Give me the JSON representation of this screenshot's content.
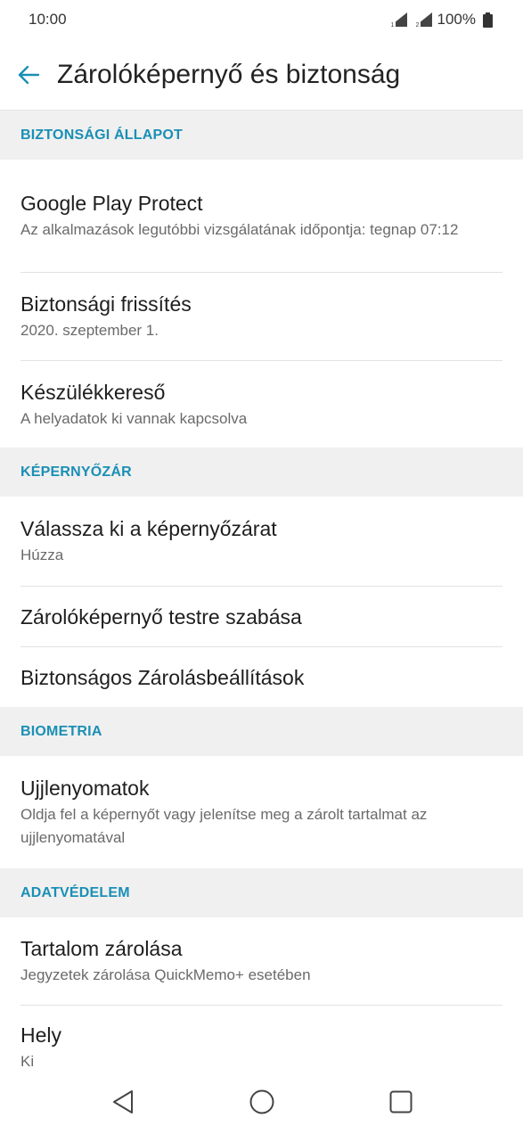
{
  "status_bar": {
    "time": "10:00",
    "battery_text": "100%",
    "sim1_label": "1",
    "sim2_label": "2",
    "icons": [
      "sim1-signal-icon",
      "sim2-signal-icon",
      "battery-icon"
    ]
  },
  "app_bar": {
    "title": "Zárolóképernyő és biztonság",
    "back_icon": "back-arrow-icon"
  },
  "colors": {
    "accent": "#1a8fb5",
    "section_bg": "#f0f0f0",
    "divider": "#e2e2e2"
  },
  "sections": {
    "security_status": {
      "header": "BIZTONSÁGI ÁLLAPOT",
      "items": [
        {
          "title": "Google Play Protect",
          "subtitle": "Az alkalmazások legutóbbi vizsgálatának időpontja: tegnap 07:12"
        },
        {
          "title": "Biztonsági frissítés",
          "subtitle": "2020. szeptember 1."
        },
        {
          "title": "Készülékkereső",
          "subtitle": "A helyadatok ki vannak kapcsolva"
        }
      ]
    },
    "screen_lock": {
      "header": "KÉPERNYŐZÁR",
      "items": [
        {
          "title": "Válassza ki a képernyőzárat",
          "subtitle": "Húzza"
        },
        {
          "title": "Zárolóképernyő testre szabása"
        },
        {
          "title": "Biztonságos Zárolásbeállítások"
        }
      ]
    },
    "biometrics": {
      "header": "BIOMETRIA",
      "items": [
        {
          "title": "Ujjlenyomatok",
          "subtitle": "Oldja fel a képernyőt vagy jelenítse meg a zárolt tartalmat az ujjlenyomatával"
        }
      ]
    },
    "privacy": {
      "header": "ADATVÉDELEM",
      "items": [
        {
          "title": "Tartalom zárolása",
          "subtitle": "Jegyzetek zárolása QuickMemo+ esetében"
        },
        {
          "title": "Hely",
          "subtitle": "Ki"
        }
      ]
    }
  },
  "nav_bar": {
    "icons": [
      "back-triangle-icon",
      "home-circle-icon",
      "recents-square-icon"
    ]
  }
}
